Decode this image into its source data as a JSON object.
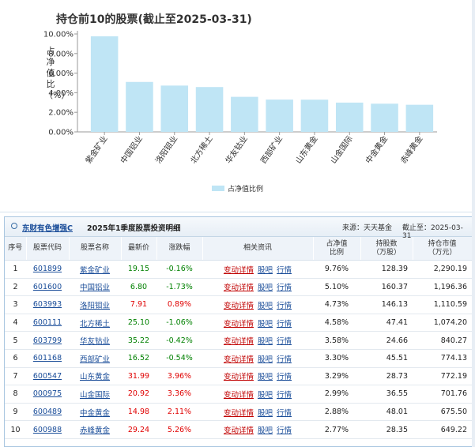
{
  "chart": {
    "title": "持仓前10的股票(截止至2025-03-31)",
    "ylabel": "占净值比（%）",
    "legend": "占净值比例",
    "bar_color": "#bfe5f5"
  },
  "chart_data": {
    "type": "bar",
    "title": "持仓前10的股票(截止至2025-03-31)",
    "categories": [
      "紫金矿业",
      "中国铝业",
      "洛阳钼业",
      "北方稀土",
      "华友钴业",
      "西部矿业",
      "山东黄金",
      "山金国际",
      "中金黄金",
      "赤峰黄金"
    ],
    "values": [
      9.76,
      5.1,
      4.73,
      4.58,
      3.58,
      3.3,
      3.29,
      2.99,
      2.88,
      2.77
    ],
    "yticks": [
      "0.00%",
      "2.00%",
      "4.00%",
      "6.00%",
      "8.00%",
      "10.00%"
    ],
    "ylim": [
      0,
      10
    ],
    "ylabel": "占净值比（%）",
    "legend": "占净值比例"
  },
  "table_header": {
    "fund_name": "东财有色增强C",
    "desc": "2025年1季度股票投资明细",
    "source": "来源：天天基金",
    "date": "截止至：2025-03-31"
  },
  "columns": [
    "序号",
    "股票代码",
    "股票名称",
    "最新价",
    "涨跌幅",
    "相关资讯",
    "占净值\n比例",
    "持股数\n（万股）",
    "持仓市值\n（万元）"
  ],
  "rel_labels": {
    "detail": "变动详情",
    "forum": "股吧",
    "quote": "行情"
  },
  "rows": [
    {
      "idx": "1",
      "code": "601899",
      "name": "紫金矿业",
      "price": "19.15",
      "change": "-0.16%",
      "dir": "neg",
      "pct": "9.76%",
      "shares": "128.39",
      "value": "2,290.19"
    },
    {
      "idx": "2",
      "code": "601600",
      "name": "中国铝业",
      "price": "6.80",
      "change": "-1.73%",
      "dir": "neg",
      "pct": "5.10%",
      "shares": "160.37",
      "value": "1,196.36"
    },
    {
      "idx": "3",
      "code": "603993",
      "name": "洛阳钼业",
      "price": "7.91",
      "change": "0.89%",
      "dir": "pos",
      "pct": "4.73%",
      "shares": "146.13",
      "value": "1,110.59"
    },
    {
      "idx": "4",
      "code": "600111",
      "name": "北方稀土",
      "price": "25.10",
      "change": "-1.06%",
      "dir": "neg",
      "pct": "4.58%",
      "shares": "47.41",
      "value": "1,074.20"
    },
    {
      "idx": "5",
      "code": "603799",
      "name": "华友钴业",
      "price": "35.22",
      "change": "-0.42%",
      "dir": "neg",
      "pct": "3.58%",
      "shares": "24.66",
      "value": "840.27"
    },
    {
      "idx": "6",
      "code": "601168",
      "name": "西部矿业",
      "price": "16.52",
      "change": "-0.54%",
      "dir": "neg",
      "pct": "3.30%",
      "shares": "45.51",
      "value": "774.13"
    },
    {
      "idx": "7",
      "code": "600547",
      "name": "山东黄金",
      "price": "31.99",
      "change": "3.96%",
      "dir": "pos",
      "pct": "3.29%",
      "shares": "28.73",
      "value": "772.19"
    },
    {
      "idx": "8",
      "code": "000975",
      "name": "山金国际",
      "price": "20.92",
      "change": "3.36%",
      "dir": "pos",
      "pct": "2.99%",
      "shares": "36.55",
      "value": "701.76"
    },
    {
      "idx": "9",
      "code": "600489",
      "name": "中金黄金",
      "price": "14.98",
      "change": "2.11%",
      "dir": "pos",
      "pct": "2.88%",
      "shares": "48.01",
      "value": "675.50"
    },
    {
      "idx": "10",
      "code": "600988",
      "name": "赤峰黄金",
      "price": "29.24",
      "change": "5.26%",
      "dir": "pos",
      "pct": "2.77%",
      "shares": "28.35",
      "value": "649.22"
    }
  ]
}
